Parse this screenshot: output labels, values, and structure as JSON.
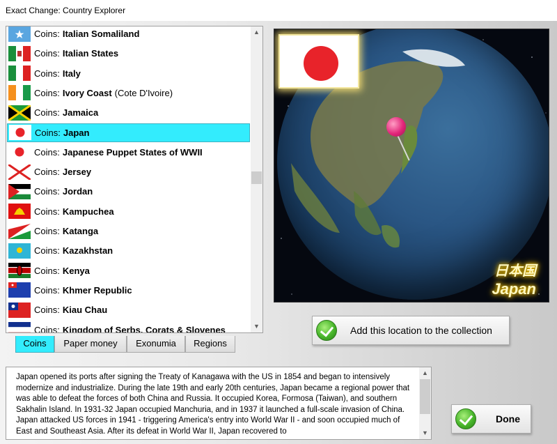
{
  "window": {
    "title": "Exact Change: Country Explorer"
  },
  "list": {
    "items": [
      {
        "prefix": "Coins:",
        "name": "Italian Somaliland",
        "alt": "",
        "flag": "somalia-flag"
      },
      {
        "prefix": "Coins:",
        "name": "Italian States",
        "alt": "",
        "flag": "italian-states-flag"
      },
      {
        "prefix": "Coins:",
        "name": "Italy",
        "alt": "",
        "flag": "italy-flag"
      },
      {
        "prefix": "Coins:",
        "name": "Ivory Coast",
        "alt": "(Cote D'Ivoire)",
        "flag": "ivory-coast-flag"
      },
      {
        "prefix": "Coins:",
        "name": "Jamaica",
        "alt": "",
        "flag": "jamaica-flag"
      },
      {
        "prefix": "Coins:",
        "name": "Japan",
        "alt": "",
        "flag": "japan-flag",
        "selected": true
      },
      {
        "prefix": "Coins:",
        "name": "Japanese Puppet States of WWII",
        "alt": "",
        "flag": "japan-flag"
      },
      {
        "prefix": "Coins:",
        "name": "Jersey",
        "alt": "",
        "flag": "jersey-flag"
      },
      {
        "prefix": "Coins:",
        "name": "Jordan",
        "alt": "",
        "flag": "jordan-flag"
      },
      {
        "prefix": "Coins:",
        "name": "Kampuchea",
        "alt": "",
        "flag": "kampuchea-flag"
      },
      {
        "prefix": "Coins:",
        "name": "Katanga",
        "alt": "",
        "flag": "katanga-flag"
      },
      {
        "prefix": "Coins:",
        "name": "Kazakhstan",
        "alt": "",
        "flag": "kazakhstan-flag"
      },
      {
        "prefix": "Coins:",
        "name": "Kenya",
        "alt": "",
        "flag": "kenya-flag"
      },
      {
        "prefix": "Coins:",
        "name": "Khmer Republic",
        "alt": "",
        "flag": "khmer-flag"
      },
      {
        "prefix": "Coins:",
        "name": "Kiau Chau",
        "alt": "",
        "flag": "kiau-chau-flag"
      },
      {
        "prefix": "Coins:",
        "name": "Kingdom of Serbs, Corats & Slovenes",
        "alt": "",
        "flag": "serbs-flag"
      }
    ]
  },
  "tabs": [
    {
      "label": "Coins",
      "active": true
    },
    {
      "label": "Paper money",
      "active": false
    },
    {
      "label": "Exonumia",
      "active": false
    },
    {
      "label": "Regions",
      "active": false
    }
  ],
  "globe": {
    "caption_native": "日本国",
    "caption_english": "Japan"
  },
  "add_button": {
    "label": "Add this location to the collection"
  },
  "description": {
    "text": "Japan opened its ports after signing the Treaty of Kanagawa with the US in 1854 and began to intensively modernize and industrialize. During the late 19th and early 20th centuries, Japan became a regional power that was able to defeat the forces of both China and Russia. It occupied Korea, Formosa (Taiwan), and southern Sakhalin Island. In 1931-32 Japan occupied Manchuria, and in 1937 it launched a full-scale invasion of China. Japan attacked US forces in 1941 - triggering America's entry into World War II - and soon occupied much of East and Southeast Asia. After its defeat in World War II, Japan recovered to"
  },
  "done_button": {
    "label": "Done"
  },
  "colors": {
    "selection": "#33ecfd",
    "japan_red": "#e8232a",
    "glow": "#f5c200"
  }
}
